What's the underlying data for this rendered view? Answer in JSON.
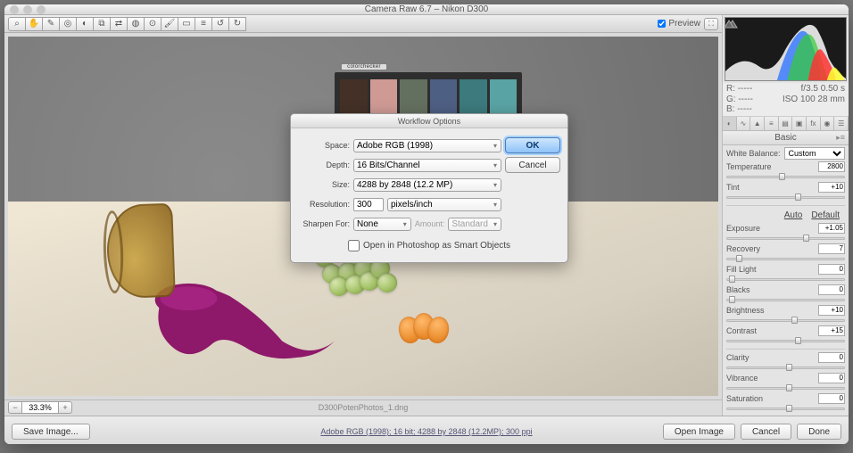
{
  "title": "Camera Raw 6.7  –  Nikon D300",
  "toolbar_icons": [
    "zoom",
    "hand",
    "eyedropper",
    "sampler",
    "crop",
    "straighten",
    "spot",
    "redeye",
    "adjust-brush",
    "grad",
    "tat",
    "rotate-ccw",
    "rotate-cw",
    "prefs"
  ],
  "preview_label": "Preview",
  "zoom": {
    "value": "33.3%",
    "filename": "D300PotenPhotos_1.dng"
  },
  "checker_label": "colorchecker",
  "checker_colors": [
    "#443026",
    "#745244",
    "#fbc6bc",
    "#4c544c",
    "#435a7f",
    "#3f7776",
    "#5e5e5e",
    "#b0b0b0",
    "#d6d6d6",
    "#f0f0f0",
    "#ffffff",
    "#202020"
  ],
  "histogram_note": "histogram",
  "meta": {
    "r": "R:  -----",
    "g": "G:  -----",
    "b": "B:  -----",
    "f": "f/3.5    0.50 s",
    "iso": "ISO 100    28 mm"
  },
  "basic_title": "Basic",
  "wb_label": "White Balance:",
  "wb_value": "Custom",
  "auto_label": "Auto",
  "default_label": "Default",
  "sliders": [
    {
      "label": "Temperature",
      "value": "2800",
      "pos": 44
    },
    {
      "label": "Tint",
      "value": "+10",
      "pos": 58
    }
  ],
  "sliders2": [
    {
      "label": "Exposure",
      "value": "+1.05",
      "pos": 65
    },
    {
      "label": "Recovery",
      "value": "7",
      "pos": 8
    },
    {
      "label": "Fill Light",
      "value": "0",
      "pos": 2
    },
    {
      "label": "Blacks",
      "value": "0",
      "pos": 2
    },
    {
      "label": "Brightness",
      "value": "+10",
      "pos": 55
    },
    {
      "label": "Contrast",
      "value": "+15",
      "pos": 58
    }
  ],
  "sliders3": [
    {
      "label": "Clarity",
      "value": "0",
      "pos": 50
    },
    {
      "label": "Vibrance",
      "value": "0",
      "pos": 50
    },
    {
      "label": "Saturation",
      "value": "0",
      "pos": 50
    }
  ],
  "dialog": {
    "title": "Workflow Options",
    "space_label": "Space:",
    "space_value": "Adobe RGB (1998)",
    "depth_label": "Depth:",
    "depth_value": "16 Bits/Channel",
    "size_label": "Size:",
    "size_value": "4288 by 2848  (12.2 MP)",
    "res_label": "Resolution:",
    "res_value": "300",
    "res_unit": "pixels/inch",
    "sharpen_label": "Sharpen For:",
    "sharpen_value": "None",
    "amount_label": "Amount:",
    "amount_value": "Standard",
    "open_smart": "Open in Photoshop as Smart Objects",
    "ok": "OK",
    "cancel": "Cancel"
  },
  "bottom": {
    "save": "Save Image...",
    "workflow": "Adobe RGB (1998); 16 bit; 4288 by 2848 (12.2MP); 300 ppi",
    "open": "Open Image",
    "cancel": "Cancel",
    "done": "Done"
  }
}
